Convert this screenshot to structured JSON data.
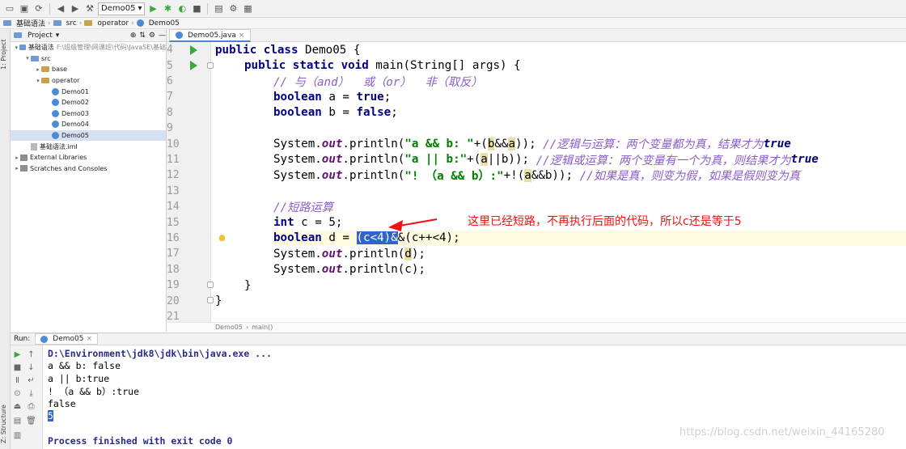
{
  "toolbar": {
    "run_config": "Demo05"
  },
  "breadcrumb": {
    "items": [
      "基础语法",
      "src",
      "operator",
      "Demo05"
    ]
  },
  "left_stripe": {
    "project_label": "1: Project",
    "structure_label": "Z: Structure"
  },
  "project_panel": {
    "header": "Project",
    "tree": [
      {
        "label": "基础语法",
        "hint": "F:\\班级管理\\网课班\\代码\\JavaSE\\基础",
        "depth": 0,
        "icon": "folder-blue",
        "arrow": "down"
      },
      {
        "label": "src",
        "hint": "",
        "depth": 1,
        "icon": "folder-blue",
        "arrow": "down"
      },
      {
        "label": "base",
        "hint": "",
        "depth": 2,
        "icon": "folder",
        "arrow": "right"
      },
      {
        "label": "operator",
        "hint": "",
        "depth": 2,
        "icon": "folder",
        "arrow": "down"
      },
      {
        "label": "Demo01",
        "hint": "",
        "depth": 3,
        "icon": "class",
        "arrow": ""
      },
      {
        "label": "Demo02",
        "hint": "",
        "depth": 3,
        "icon": "class",
        "arrow": ""
      },
      {
        "label": "Demo03",
        "hint": "",
        "depth": 3,
        "icon": "class",
        "arrow": ""
      },
      {
        "label": "Demo04",
        "hint": "",
        "depth": 3,
        "icon": "class",
        "arrow": ""
      },
      {
        "label": "Demo05",
        "hint": "",
        "depth": 3,
        "icon": "class",
        "arrow": "",
        "selected": true
      },
      {
        "label": "基础语法.iml",
        "hint": "",
        "depth": 1,
        "icon": "file",
        "arrow": ""
      },
      {
        "label": "External Libraries",
        "hint": "",
        "depth": 0,
        "icon": "lib",
        "arrow": "right"
      },
      {
        "label": "Scratches and Consoles",
        "hint": "",
        "depth": 0,
        "icon": "lib",
        "arrow": "right"
      }
    ]
  },
  "editor": {
    "tab": "Demo05.java",
    "line_numbers": [
      "4",
      "5",
      "6",
      "7",
      "8",
      "9",
      "10",
      "11",
      "12",
      "13",
      "14",
      "15",
      "16",
      "17",
      "18",
      "19",
      "20",
      "21"
    ],
    "crumb": [
      "Demo05",
      "main()"
    ]
  },
  "code": {
    "l4": {
      "kw": "public class",
      "rest": " Demo05 {"
    },
    "l5": {
      "kw": "public static void",
      "rest": " main(String[] args) {"
    },
    "l6": "// 与（and）  或（or）  非（取反）",
    "l7": {
      "kw": "boolean",
      "rest": " a = ",
      "val": "true",
      "end": ";"
    },
    "l8": {
      "kw": "boolean",
      "rest": " b = ",
      "val": "false",
      "end": ";"
    },
    "l10": {
      "a": "System.",
      "f": "out",
      "b": ".println(",
      "s": "\"a && b: \"",
      "c": "+(",
      "h1": "b",
      "d": "&&",
      "h2": "a",
      "e": ")); ",
      "cm": "//逻辑与运算：两个变量都为真，结果才为",
      "cmkw": "true"
    },
    "l11": {
      "a": "System.",
      "f": "out",
      "b": ".println(",
      "s": "\"a || b:\"",
      "c": "+(",
      "h1": "a",
      "d": "||b)); ",
      "cm": "//逻辑或运算：两个变量有一个为真，则结果才为",
      "cmkw": "true"
    },
    "l12": {
      "a": "System.",
      "f": "out",
      "b": ".println(",
      "s": "\"! （a && b）:\"",
      "c": "+!(",
      "h1": "a",
      "d": "&&b)); ",
      "cm": "//如果是真，则变为假，如果是假则变为真"
    },
    "l14": "//短路运算",
    "l15": {
      "kw": "int",
      "rest": " c = 5;"
    },
    "l16": {
      "kw": "boolean",
      "rest": " d = ",
      "sel": "(c<4)&",
      "tail": "&(c++<4);"
    },
    "l17": {
      "a": "System.",
      "f": "out",
      "b": ".println(",
      "h1": "d",
      "e": ");"
    },
    "l18": {
      "a": "System.",
      "f": "out",
      "b": ".println(c);"
    },
    "l19": "}",
    "l20": "}"
  },
  "annotation": {
    "text": "这里已经短路，不再执行后面的代码，所以c还是等于5",
    "color": "#ee1111"
  },
  "run_panel": {
    "label": "Run:",
    "tab": "Demo05",
    "lines": [
      "D:\\Environment\\jdk8\\jdk\\bin\\java.exe ...",
      "a && b: false",
      "a || b:true",
      "! （a && b）:true",
      "false",
      "5",
      "",
      "Process finished with exit code 0"
    ]
  },
  "watermark": "https://blog.csdn.net/weixin_44165280"
}
